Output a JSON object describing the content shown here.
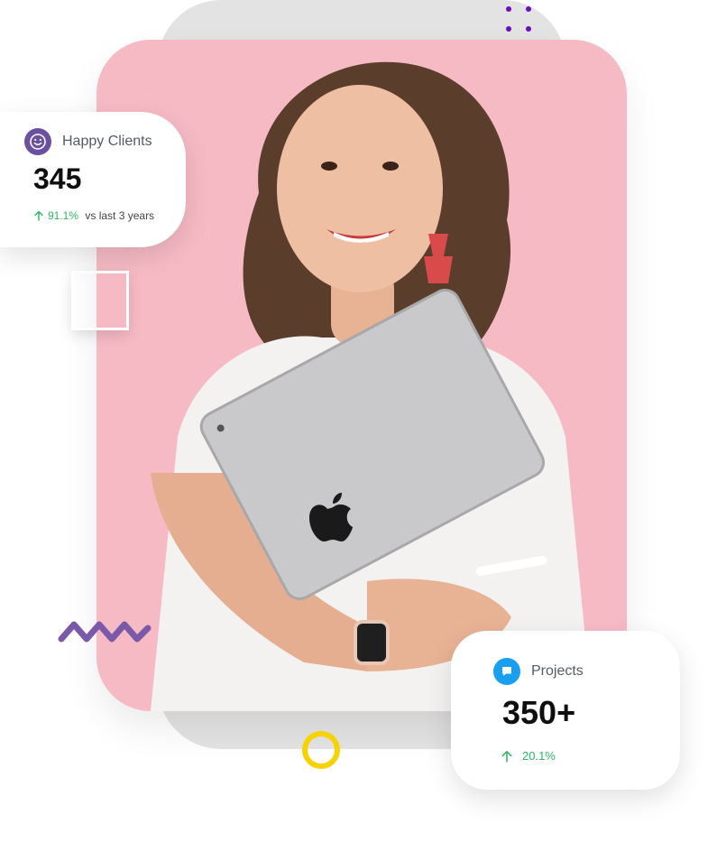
{
  "happy_clients": {
    "title": "Happy Clients",
    "value": "345",
    "trend_percent": "91.1%",
    "trend_suffix": " vs last 3 years",
    "icon": "smiley-icon",
    "icon_color": "#6b4fa0"
  },
  "projects": {
    "title": "Projects",
    "value": "350+",
    "trend_percent": "20.1%",
    "icon": "chat-bubble-icon",
    "icon_color": "#1a9ef0"
  },
  "colors": {
    "pink_panel": "#f6bac4",
    "back_panel": "#e3e3e3",
    "trend_up": "#2fb562",
    "dots": "#6a0dc4",
    "zigzag": "#7a5aa8",
    "ring": "#f6d300"
  }
}
